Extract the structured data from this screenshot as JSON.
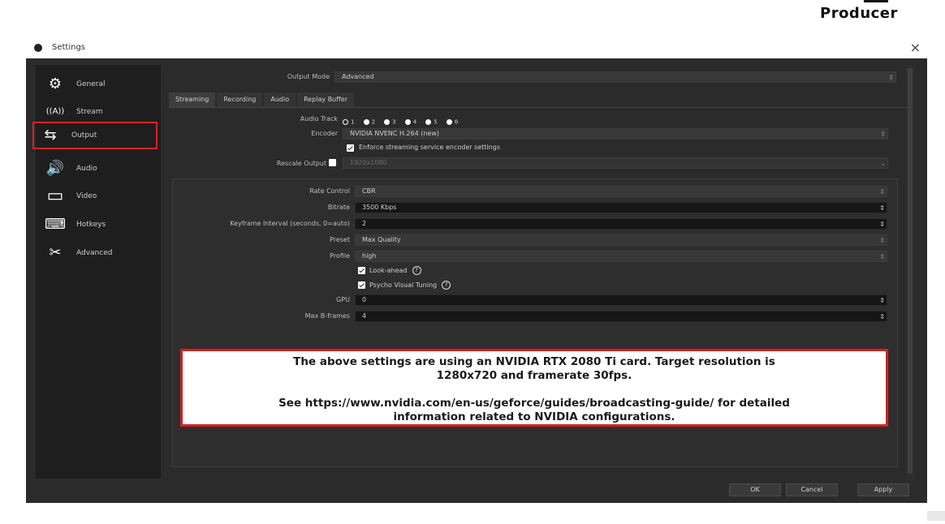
{
  "brand": "Producer",
  "window": {
    "title": "Settings",
    "close_glyph": "×"
  },
  "sidebar": {
    "items": [
      {
        "label": "General",
        "icon": "gear-icon",
        "glyph": "⚙"
      },
      {
        "label": "Stream",
        "icon": "antenna-icon",
        "glyph": "((A))"
      },
      {
        "label": "Output",
        "icon": "output-icon",
        "glyph": "⇆",
        "selected": true
      },
      {
        "label": "Audio",
        "icon": "speaker-icon",
        "glyph": "🔊"
      },
      {
        "label": "Video",
        "icon": "monitor-icon",
        "glyph": "▭"
      },
      {
        "label": "Hotkeys",
        "icon": "keyboard-icon",
        "glyph": "⌨"
      },
      {
        "label": "Advanced",
        "icon": "tools-icon",
        "glyph": "✂"
      }
    ]
  },
  "output": {
    "mode_label": "Output Mode",
    "mode_value": "Advanced",
    "tabs": [
      "Streaming",
      "Recording",
      "Audio",
      "Replay Buffer"
    ],
    "active_tab": "Streaming",
    "audio_track_label": "Audio Track",
    "audio_tracks": [
      "1",
      "2",
      "3",
      "4",
      "5",
      "6"
    ],
    "encoder_label": "Encoder",
    "encoder_value": "NVIDIA NVENC H.264 (new)",
    "enforce_label": "Enforce streaming service encoder settings",
    "rescale_label": "Rescale Output",
    "rescale_value": "1920x1080"
  },
  "encoder_settings": {
    "rate_control_label": "Rate Control",
    "rate_control_value": "CBR",
    "bitrate_label": "Bitrate",
    "bitrate_value": "3500 Kbps",
    "keyframe_label": "Keyframe Interval (seconds, 0=auto)",
    "keyframe_value": "2",
    "preset_label": "Preset",
    "preset_value": "Max Quality",
    "profile_label": "Profile",
    "profile_value": "high",
    "lookahead_label": "Look-ahead",
    "psycho_label": "Psycho Visual Tuning",
    "gpu_label": "GPU",
    "gpu_value": "0",
    "bframes_label": "Max B-frames",
    "bframes_value": "4"
  },
  "note": {
    "line1": "The above settings are using an NVIDIA RTX 2080 Ti card. Target resolution is",
    "line2": "1280x720 and framerate 30fps.",
    "line3": "See https://www.nvidia.com/en-us/geforce/guides/broadcasting-guide/ for detailed",
    "line4": "information related to NVIDIA configurations."
  },
  "buttons": {
    "ok": "OK",
    "cancel": "Cancel",
    "apply": "Apply"
  },
  "colors": {
    "highlight": "#d42020",
    "window_bg": "#2b2b2b",
    "sidebar_bg": "#1e1e1e"
  }
}
